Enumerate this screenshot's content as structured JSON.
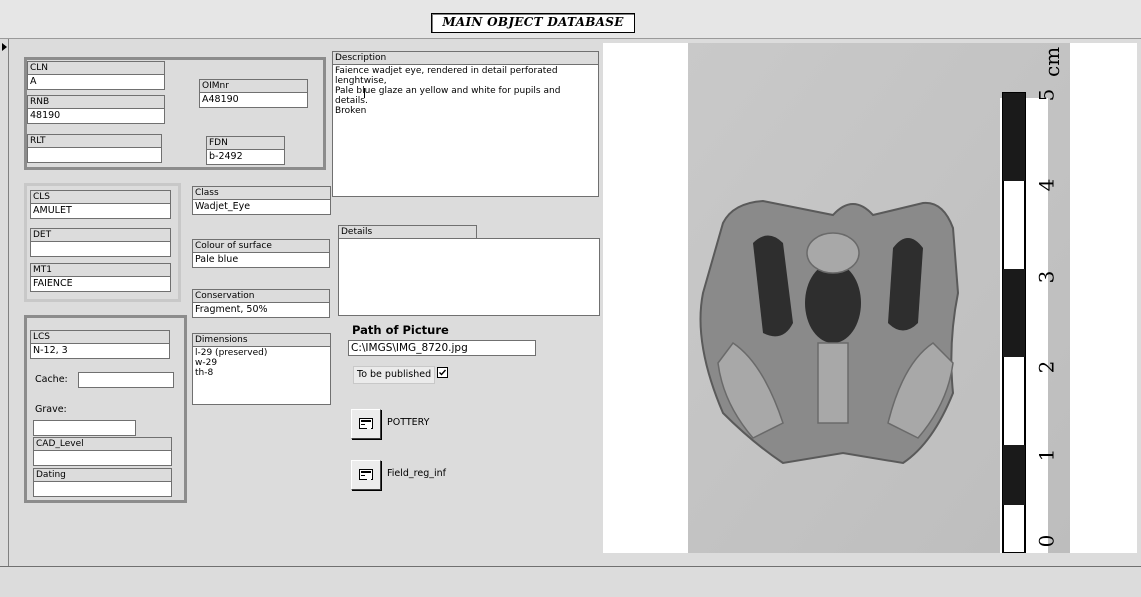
{
  "header": {
    "title": "MAIN OBJECT DATABASE"
  },
  "fields": {
    "cln": {
      "label": "CLN",
      "value": "A"
    },
    "rnb": {
      "label": "RNB",
      "value": "48190"
    },
    "rlt": {
      "label": "RLT",
      "value": ""
    },
    "oimnr": {
      "label": "OIMnr",
      "value": "A48190"
    },
    "fdn": {
      "label": "FDN",
      "value": "b-2492"
    },
    "cls": {
      "label": "CLS",
      "value": "AMULET"
    },
    "det": {
      "label": "DET",
      "value": ""
    },
    "mt1": {
      "label": "MT1",
      "value": "FAIENCE"
    },
    "class": {
      "label": "Class",
      "value": "Wadjet_Eye"
    },
    "colour_of_surface": {
      "label": "Colour of surface",
      "value": "Pale blue"
    },
    "conservation": {
      "label": "Conservation",
      "value": "Fragment, 50%"
    },
    "dimensions": {
      "label": "Dimensions",
      "value": "l-29 (preserved)\nw-29\nth-8"
    },
    "lcs": {
      "label": "LCS",
      "value": "N-12, 3"
    },
    "cache": {
      "label": "Cache:",
      "value": ""
    },
    "grave": {
      "label": "Grave:",
      "value": ""
    },
    "cad_level": {
      "label": "CAD_Level",
      "value": ""
    },
    "dating": {
      "label": "Dating",
      "value": ""
    },
    "description": {
      "label": "Description",
      "value": "Faience wadjet eye, rendered in detail perforated lenghtwise,\nPale blue glaze an yellow and white for pupils and details.\nBroken"
    },
    "details": {
      "label": "Details",
      "value": ""
    }
  },
  "picture": {
    "heading": "Path of Picture",
    "path": "C:\\IMGS\\IMG_8720.jpg",
    "publish_label": "To be published",
    "publish_checked": true
  },
  "buttons": {
    "pottery": "POTTERY",
    "field_reg": "Field_reg_inf"
  },
  "photo": {
    "scale_unit": "cm",
    "scale_numbers": [
      "5",
      "4",
      "3",
      "2",
      "1",
      "0"
    ]
  }
}
